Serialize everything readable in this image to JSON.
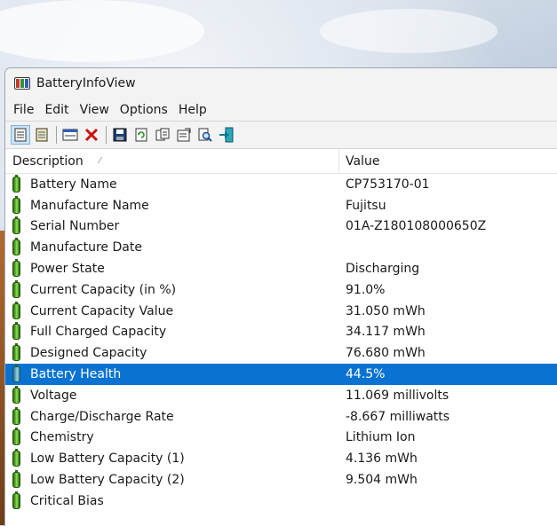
{
  "window": {
    "title": "BatteryInfoView"
  },
  "menu": [
    "File",
    "Edit",
    "View",
    "Options",
    "Help"
  ],
  "toolbar": {
    "icons": [
      "html-report-icon",
      "properties-list-icon",
      "window-icon",
      "delete-icon",
      "save-icon",
      "refresh-icon",
      "copy-icon",
      "properties-icon",
      "find-icon",
      "exit-icon"
    ]
  },
  "columns": {
    "description": "Description",
    "value": "Value"
  },
  "rows": [
    {
      "label": "Battery Name",
      "value": "CP753170-01"
    },
    {
      "label": "Manufacture Name",
      "value": "Fujitsu"
    },
    {
      "label": "Serial Number",
      "value": "01A-Z180108000650Z"
    },
    {
      "label": "Manufacture Date",
      "value": ""
    },
    {
      "label": "Power State",
      "value": "Discharging"
    },
    {
      "label": "Current Capacity (in %)",
      "value": "91.0%"
    },
    {
      "label": "Current Capacity Value",
      "value": "31.050 mWh"
    },
    {
      "label": "Full Charged Capacity",
      "value": "34.117 mWh"
    },
    {
      "label": "Designed Capacity",
      "value": "76.680 mWh"
    },
    {
      "label": "Battery Health",
      "value": "44.5%"
    },
    {
      "label": "Voltage",
      "value": "11.069 millivolts"
    },
    {
      "label": "Charge/Discharge Rate",
      "value": "-8.667 milliwatts"
    },
    {
      "label": "Chemistry",
      "value": "Lithium Ion"
    },
    {
      "label": "Low Battery Capacity (1)",
      "value": "4.136 mWh"
    },
    {
      "label": "Low Battery Capacity (2)",
      "value": "9.504 mWh"
    },
    {
      "label": "Critical Bias",
      "value": ""
    }
  ],
  "selected_row": "Battery Health",
  "colors": {
    "selection": "#0a73d2",
    "battery_icon": "#5fb02f"
  }
}
